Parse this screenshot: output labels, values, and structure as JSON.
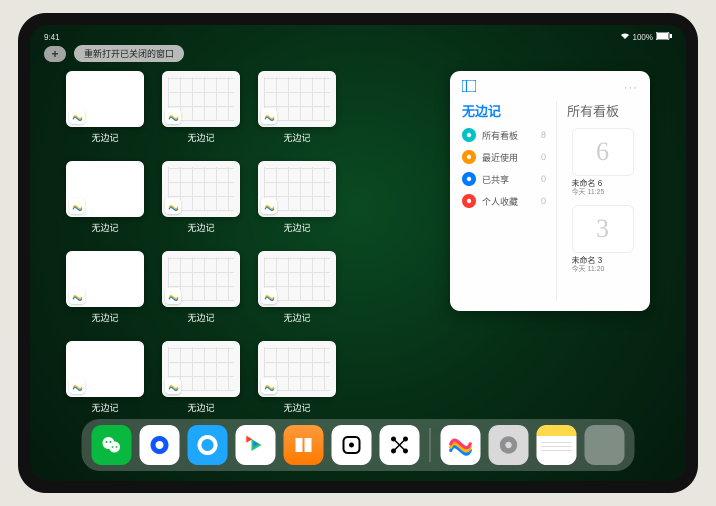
{
  "status": {
    "time": "9:41",
    "battery": "100%"
  },
  "top": {
    "plus": "+",
    "reopen": "重新打开已关闭的窗口"
  },
  "apps": [
    {
      "label": "无边记",
      "variant": "blank"
    },
    {
      "label": "无边记",
      "variant": "grid"
    },
    {
      "label": "无边记",
      "variant": "grid"
    },
    {
      "label": "无边记",
      "variant": "blank"
    },
    {
      "label": "无边记",
      "variant": "grid"
    },
    {
      "label": "无边记",
      "variant": "grid"
    },
    {
      "label": "无边记",
      "variant": "blank"
    },
    {
      "label": "无边记",
      "variant": "grid"
    },
    {
      "label": "无边记",
      "variant": "grid"
    },
    {
      "label": "无边记",
      "variant": "blank"
    },
    {
      "label": "无边记",
      "variant": "grid"
    },
    {
      "label": "无边记",
      "variant": "grid"
    }
  ],
  "panel": {
    "title_left": "无边记",
    "title_right": "所有看板",
    "more": "···",
    "categories": [
      {
        "icon_color": "#00c2c7",
        "label": "所有看板",
        "count": "8"
      },
      {
        "icon_color": "#ff9500",
        "label": "最近使用",
        "count": "0"
      },
      {
        "icon_color": "#007aff",
        "label": "已共享",
        "count": "0"
      },
      {
        "icon_color": "#ff3b30",
        "label": "个人收藏",
        "count": "0"
      }
    ],
    "boards": [
      {
        "glyph": "6",
        "name": "未命名 6",
        "time": "今天 11:25"
      },
      {
        "glyph": "3",
        "name": "未命名 3",
        "time": "今天 11:20"
      }
    ]
  },
  "dock": [
    {
      "name": "wechat",
      "bg": "#09b83e",
      "glyph": "chat"
    },
    {
      "name": "tencent-video",
      "bg": "#ffffff",
      "glyph": "play-blue"
    },
    {
      "name": "qq-browser",
      "bg": "#1ea7fd",
      "glyph": "ring"
    },
    {
      "name": "aiqiyi",
      "bg": "#ffffff",
      "glyph": "play-multi"
    },
    {
      "name": "books",
      "bg": "linear-gradient(#ff9a3c,#ff7a00)",
      "glyph": "books"
    },
    {
      "name": "dice",
      "bg": "#ffffff",
      "glyph": "dice"
    },
    {
      "name": "nodes",
      "bg": "#ffffff",
      "glyph": "nodes"
    },
    {
      "name": "freeform",
      "bg": "#ffffff",
      "glyph": "freeform"
    },
    {
      "name": "settings",
      "bg": "#d9d9d9",
      "glyph": "gear"
    },
    {
      "name": "notes",
      "bg": "#ffffff",
      "glyph": "notes"
    },
    {
      "name": "folder",
      "bg": "folder",
      "glyph": "folder"
    }
  ]
}
